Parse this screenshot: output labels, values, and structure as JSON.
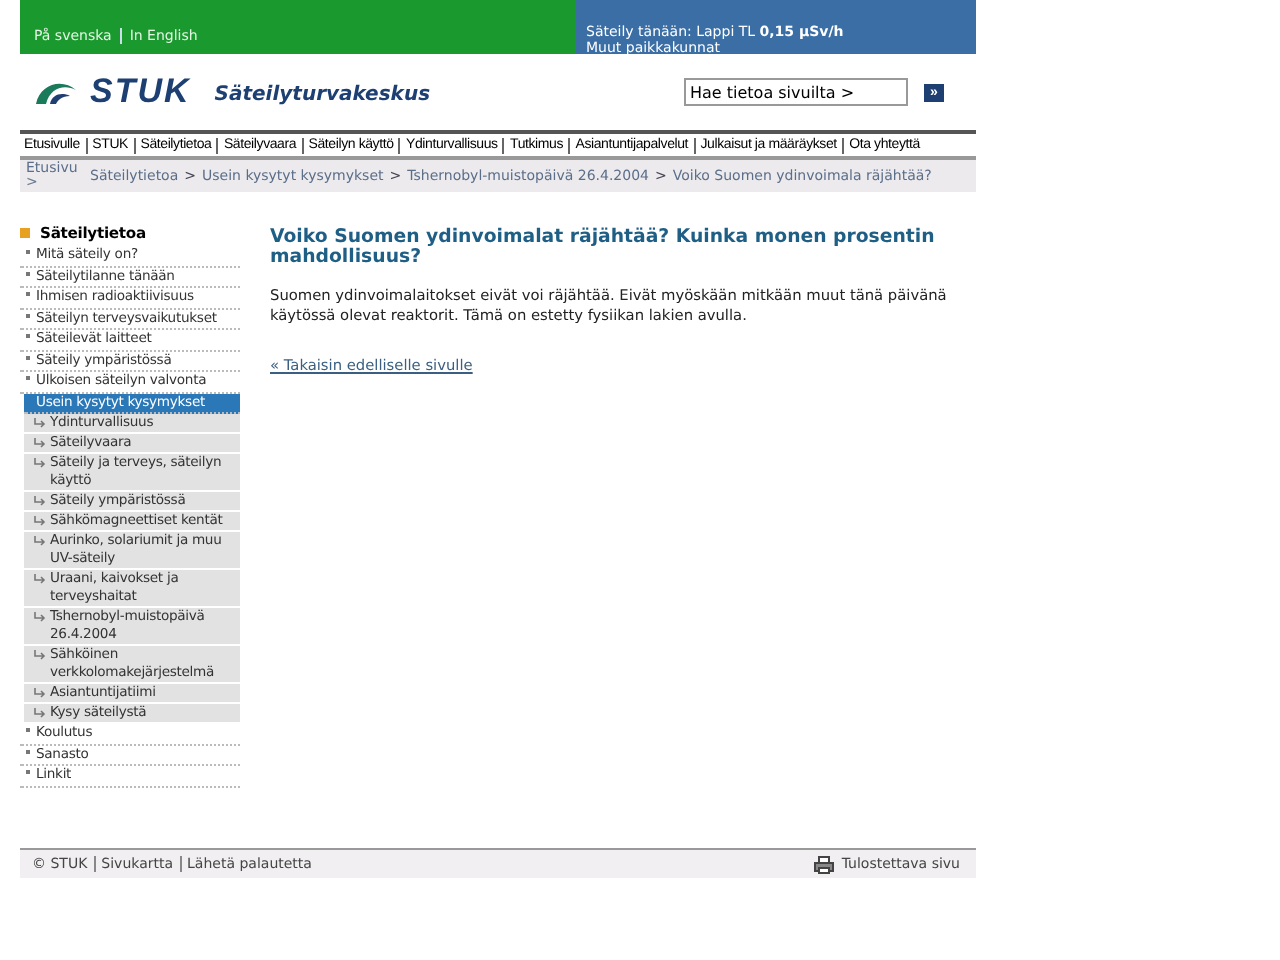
{
  "top_bar": {
    "languages": [
      "På svenska",
      "In English"
    ],
    "radiation_text": "Säteily tänään: Lappi TL **0,15 µSv/h**",
    "radiation_link": "Muut paikkakunnat"
  },
  "header": {
    "logo_text": "STUK",
    "site_name": "Säteilyturvakeskus",
    "search": {
      "placeholder": "Hae tietoa sivuilta >"
    },
    "search_button": "»"
  },
  "nav": [
    "Etusivulle",
    "STUK",
    "Säteilytietoa",
    "Säteilyvaara",
    "Säteilyn käyttö",
    "Ydinturvallisuus",
    "Tutkimus",
    "Asiantuntijapalvelut",
    "Julkaisut ja määräykset",
    "Ota yhteyttä"
  ],
  "breadcrumb": {
    "separator": ">",
    "items": [
      "Etusivu",
      "Säteilytietoa",
      "Usein kysytyt kysymykset",
      "Tshernobyl-muistopäivä 26.4.2004",
      "Voiko Suomen ydinvoimala räjähtää?"
    ]
  },
  "sidebar": {
    "title": "Säteilytietoa",
    "items": [
      {
        "label": "Mitä säteily on?",
        "selected": false
      },
      {
        "label": "Säteilytilanne tänään",
        "selected": false
      },
      {
        "label": "Ihmisen radioaktiivisuus",
        "selected": false
      },
      {
        "label": "Säteilyn terveysvaikutukset",
        "selected": false
      },
      {
        "label": "Säteilevät laitteet",
        "selected": false
      },
      {
        "label": "Säteily ympäristössä",
        "selected": false
      },
      {
        "label": "Ulkoisen säteilyn valvonta",
        "selected": false
      },
      {
        "label": "Usein kysytyt kysymykset",
        "selected": true,
        "children": [
          {
            "label": "Ydinturvallisuus",
            "selected": false
          },
          {
            "label": "Säteilyvaara",
            "selected": false
          },
          {
            "label": "Säteily ja terveys, säteilyn käyttö",
            "selected": false
          },
          {
            "label": "Säteily ympäristössä",
            "selected": false
          },
          {
            "label": "Sähkömagneettiset kentät",
            "selected": false
          },
          {
            "label": "Aurinko, solariumit ja muu UV-säteily",
            "selected": false
          },
          {
            "label": "Uraani, kaivokset ja terveyshaitat",
            "selected": false
          },
          {
            "label": "Tshernobyl-muistopäivä 26.4.2004",
            "selected": false
          },
          {
            "label": "Sähköinen verkkolomakejärjestelmä",
            "selected": false
          },
          {
            "label": "Asiantuntijatiimi",
            "selected": false
          },
          {
            "label": "Kysy säteilystä",
            "selected": false
          }
        ]
      },
      {
        "label": "Koulutus",
        "selected": false
      },
      {
        "label": "Sanasto",
        "selected": false
      },
      {
        "label": "Linkit",
        "selected": false
      }
    ]
  },
  "article": {
    "title": "Voiko Suomen ydinvoimalat räjähtää? Kuinka monen prosentin mahdollisuus?",
    "body": "Suomen ydinvoimalaitokset eivät voi räjähtää. Eivät myöskään mitkään muut tänä päivänä käytössä olevat reaktorit. Tämä on estetty fysiikan lakien avulla.",
    "back_link": "« Takaisin edelliselle sivulle"
  },
  "footer": {
    "links": [
      "© STUK",
      "Sivukartta",
      "Lähetä palautetta"
    ],
    "print_link": "Tulostettava sivu"
  }
}
